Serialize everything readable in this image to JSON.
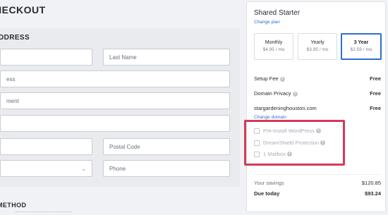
{
  "page": {
    "title": "HECKOUT"
  },
  "address": {
    "heading": "DDRESS",
    "fields": {
      "first_name": "",
      "last_name": "Last Name",
      "address": "ess",
      "apartment": "ment",
      "city": "",
      "state": "",
      "postal_code": "Postal Code",
      "country": "",
      "phone": "Phone"
    }
  },
  "payment": {
    "heading": "METHOD"
  },
  "summary": {
    "plan_name": "Shared Starter",
    "change_plan": "Change plan",
    "terms": [
      {
        "label": "Monthly",
        "price": "$4.95 / mo",
        "selected": false
      },
      {
        "label": "Yearly",
        "price": "$3.95 / mo",
        "selected": false
      },
      {
        "label": "3 Year",
        "price": "$2.59 / mo",
        "selected": true
      }
    ],
    "fees": [
      {
        "label": "Setup Fee",
        "value": "Free"
      },
      {
        "label": "Domain Privacy",
        "value": "Free"
      }
    ],
    "domain": {
      "name": "stargardeninghouston.com",
      "value": "Free",
      "change_link": "Change domain"
    },
    "addons": [
      {
        "label": "Pre-Install WordPress",
        "checked": false
      },
      {
        "label": "DreamShield Protection",
        "checked": false
      },
      {
        "label": "1 Mailbox",
        "checked": false
      }
    ],
    "savings": {
      "label": "Your savings",
      "value": "$120.85"
    },
    "due_today": {
      "label": "Due today",
      "value": "$93.24"
    }
  },
  "colors": {
    "accent": "#2d6fcf",
    "highlight": "#d43a5a"
  },
  "icons": {
    "info": "info-icon",
    "select": "chevron-down-icon"
  }
}
